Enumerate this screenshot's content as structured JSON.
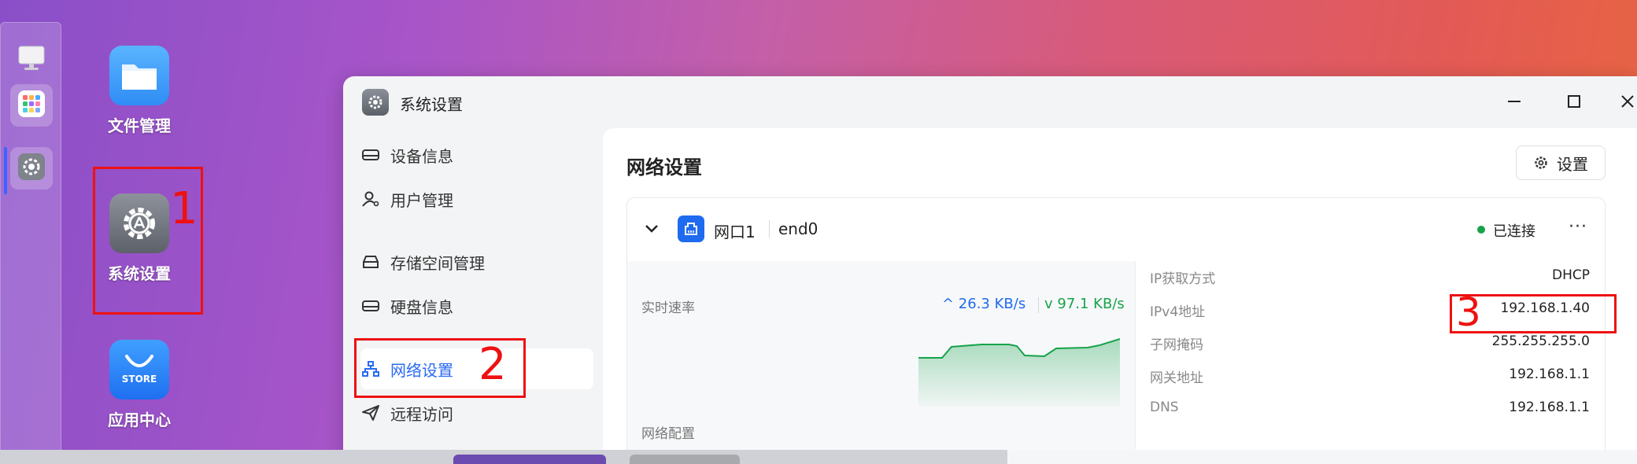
{
  "desktop": {
    "icons": [
      {
        "label": "文件管理"
      },
      {
        "label": "系统设置"
      },
      {
        "label": "应用中心"
      }
    ],
    "store_text": "STORE"
  },
  "annotations": {
    "n1": "1",
    "n2": "2",
    "n3": "3"
  },
  "window": {
    "title": "系统设置",
    "sidebar": [
      {
        "label": "设备信息"
      },
      {
        "label": "用户管理"
      },
      {
        "label": "存储空间管理"
      },
      {
        "label": "硬盘信息"
      },
      {
        "label": "网络设置"
      },
      {
        "label": "远程访问"
      }
    ],
    "content": {
      "title": "网络设置",
      "settings_button": "设置",
      "port": {
        "name": "网口1",
        "device": "end0",
        "status": "已连接",
        "more": "···"
      },
      "rate": {
        "label": "实时速率",
        "up": "^ 26.3 KB/s",
        "down": "v 97.1 KB/s"
      },
      "net_config_label": "网络配置",
      "info": [
        {
          "key": "IP获取方式",
          "value": "DHCP"
        },
        {
          "key": "IPv4地址",
          "value": "192.168.1.40"
        },
        {
          "key": "子网掩码",
          "value": "255.255.255.0"
        },
        {
          "key": "网关地址",
          "value": "192.168.1.1"
        },
        {
          "key": "DNS",
          "value": "192.168.1.1"
        }
      ]
    }
  },
  "colors": {
    "accent": "#1e6bf0",
    "connected": "#16a34a",
    "annotation": "#ee1111"
  }
}
